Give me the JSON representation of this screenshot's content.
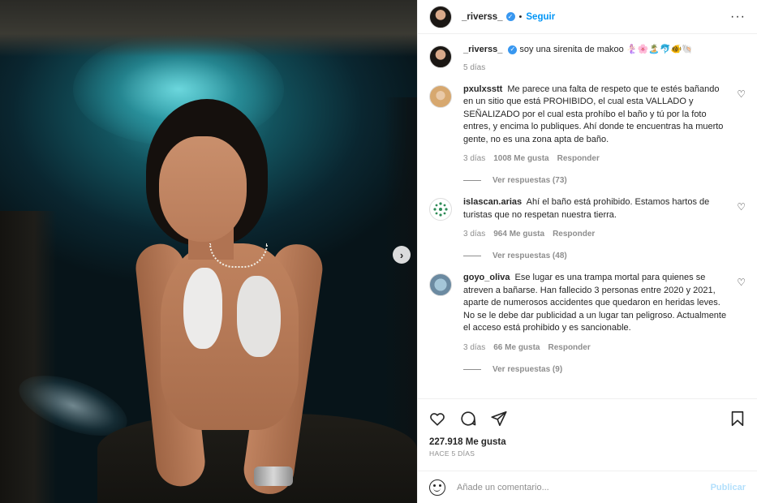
{
  "header": {
    "username": "_riverss_",
    "dot": "•",
    "follow_label": "Seguir",
    "more_icon": "···"
  },
  "caption": {
    "username": "_riverss_",
    "text": "soy una sirenita de makoo 🧜🏻‍♀️🌸🏝️🐬🐠🐚",
    "time": "5 días"
  },
  "comments": [
    {
      "username": "pxulxsstt",
      "text": "Me parece una falta de respeto que te estés bañando en un sitio que está PROHIBIDO, el cual esta VALLADO y SEÑALIZADO por el cual esta prohíbo el baño y tú por la foto entres, y encima lo publiques. Ahí donde te encuentras ha muerto gente, no es una zona apta de baño.",
      "time": "3 días",
      "likes": "1008 Me gusta",
      "reply_label": "Responder",
      "replies_label": "Ver respuestas (73)"
    },
    {
      "username": "islascan.arias",
      "text": "Ahí el baño está prohibido. Estamos hartos de turistas que no respetan nuestra tierra.",
      "time": "3 días",
      "likes": "964 Me gusta",
      "reply_label": "Responder",
      "replies_label": "Ver respuestas (48)"
    },
    {
      "username": "goyo_oliva",
      "text": "Ese lugar es una trampa mortal para quienes se atreven a bañarse. Han fallecido 3 personas entre 2020 y 2021, aparte de numerosos accidentes que quedaron en heridas leves. No se le debe dar publicidad a un lugar tan peligroso. Actualmente el acceso está prohibido y es sancionable.",
      "time": "3 días",
      "likes": "66 Me gusta",
      "reply_label": "Responder",
      "replies_label": "Ver respuestas (9)"
    }
  ],
  "actions": {
    "like_icon": "heart-icon",
    "comment_icon": "comment-icon",
    "share_icon": "share-icon",
    "save_icon": "bookmark-icon"
  },
  "likes": "227.918 Me gusta",
  "post_date": "HACE 5 DÍAS",
  "add_comment": {
    "placeholder": "Añade un comentario...",
    "publish_label": "Publicar"
  },
  "colors": {
    "accent": "#0095f6",
    "verified": "#3897f0",
    "muted": "#8e8e8e",
    "publish_disabled": "#b2dffc"
  }
}
